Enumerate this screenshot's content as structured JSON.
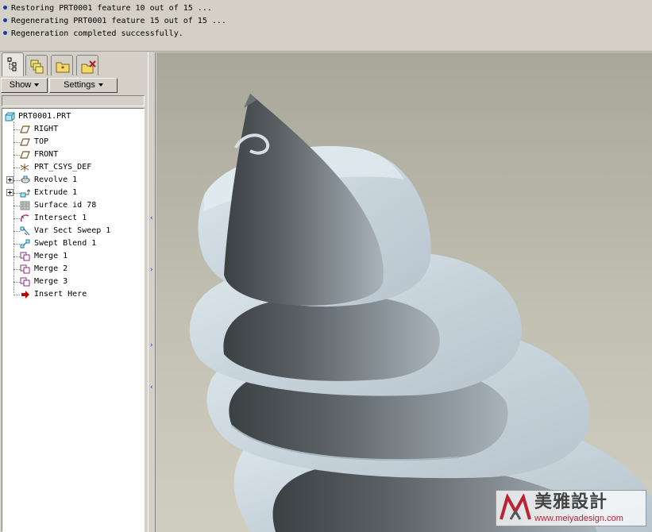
{
  "messages": [
    "Restoring PRT0001 feature 10 out of 15 ...",
    "Regenerating PRT0001 feature 15 out of 15 ...",
    "Regeneration completed successfully."
  ],
  "navigator": {
    "tabs": [
      {
        "icon": "model-tree-icon"
      },
      {
        "icon": "layers-icon"
      },
      {
        "icon": "favorites-folder-icon"
      },
      {
        "icon": "connections-icon"
      }
    ],
    "show_label": "Show",
    "settings_label": "Settings"
  },
  "model_tree": {
    "root": "PRT0001.PRT",
    "items": [
      {
        "label": "RIGHT",
        "icon": "datum-plane-icon"
      },
      {
        "label": "TOP",
        "icon": "datum-plane-icon"
      },
      {
        "label": "FRONT",
        "icon": "datum-plane-icon"
      },
      {
        "label": "PRT_CSYS_DEF",
        "icon": "csys-icon"
      },
      {
        "label": "Revolve 1",
        "icon": "revolve-icon"
      },
      {
        "label": "Extrude 1",
        "icon": "extrude-icon"
      },
      {
        "label": "Surface id 78",
        "icon": "surface-icon"
      },
      {
        "label": "Intersect 1",
        "icon": "intersect-icon"
      },
      {
        "label": "Var Sect Sweep 1",
        "icon": "var-sect-sweep-icon"
      },
      {
        "label": "Swept Blend 1",
        "icon": "swept-blend-icon"
      },
      {
        "label": "Merge 1",
        "icon": "merge-icon"
      },
      {
        "label": "Merge 2",
        "icon": "merge-icon"
      },
      {
        "label": "Merge 3",
        "icon": "merge-icon"
      },
      {
        "label": "Insert Here",
        "icon": "insert-here-arrow-icon"
      }
    ]
  },
  "watermark": {
    "title": "美雅設計",
    "url": "www.meiyadesign.com"
  },
  "colors": {
    "bullet": "#1a3fb0",
    "insert_arrow": "#c00000",
    "background_top": "#a8a79a",
    "model_surface": "#c9d5de"
  }
}
